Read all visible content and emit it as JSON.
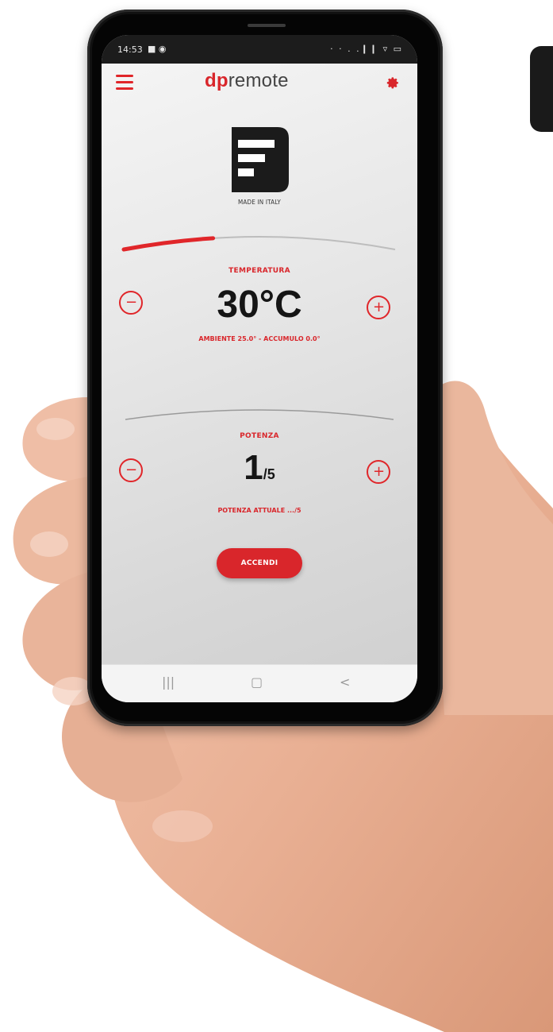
{
  "status_bar": {
    "time": "14:53",
    "left_icons": "■ ◉",
    "right_icons": "· · . .❙❙ ▿ ▭"
  },
  "header": {
    "menu_icon": "hamburger-menu-icon",
    "logo_prefix": "dp",
    "logo_suffix": "remote",
    "settings_icon": "gear-icon"
  },
  "brand": {
    "caption": "MADE IN ITALY"
  },
  "temperature": {
    "label": "TEMPERATURA",
    "value": "30°C",
    "detail": "AMBIENTE 25.0° - ACCUMULO 0.0°",
    "decrease_symbol": "−",
    "increase_symbol": "+",
    "progress_fraction": 0.33
  },
  "power": {
    "label": "POTENZA",
    "value": "1",
    "max": "/5",
    "detail": "POTENZA ATTUALE .../5",
    "decrease_symbol": "−",
    "increase_symbol": "+"
  },
  "action": {
    "label": "ACCENDI"
  },
  "nav": {
    "recent": "|||",
    "home": "▢",
    "back": "<"
  },
  "colors": {
    "accent": "#d9262b",
    "text_dark": "#151515",
    "screen_bg": "#e7e7e7"
  }
}
